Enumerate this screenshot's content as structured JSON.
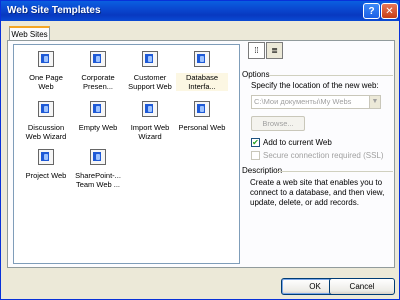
{
  "window": {
    "title": "Web Site Templates",
    "help_label": "?",
    "close_label": "✕"
  },
  "tabs": [
    {
      "label": "Web Sites"
    }
  ],
  "templates": [
    {
      "label": "One Page\nWeb",
      "icon": "one-page-web-icon"
    },
    {
      "label": "Corporate\nPresen...",
      "icon": "corporate-presence-icon"
    },
    {
      "label": "Customer\nSupport Web",
      "icon": "customer-support-icon"
    },
    {
      "label": "Database\nInterfa...",
      "icon": "database-interface-icon",
      "selected": true
    },
    {
      "label": "Discussion\nWeb Wizard",
      "icon": "discussion-web-icon"
    },
    {
      "label": "Empty Web",
      "icon": "empty-web-icon"
    },
    {
      "label": "Import Web\nWizard",
      "icon": "import-web-icon"
    },
    {
      "label": "Personal Web",
      "icon": "personal-web-icon"
    },
    {
      "label": "Project Web",
      "icon": "project-web-icon"
    },
    {
      "label": "SharePoint-...\nTeam Web ...",
      "icon": "sharepoint-team-icon"
    }
  ],
  "view_buttons": [
    {
      "label": "⁞⁞",
      "icon": "large-icons-view-icon"
    },
    {
      "label": "≣",
      "icon": "list-view-icon"
    }
  ],
  "options": {
    "heading": "Options",
    "location_label": "Specify the location of the new web:",
    "location_value": "C:\\Мои документы\\My Webs",
    "browse_label": "Browse...",
    "add_to_current_web_label": "Add to current Web",
    "add_to_current_web_checked": true,
    "secure_connection_label": "Secure connection required (SSL)",
    "secure_connection_checked": false
  },
  "description": {
    "heading": "Description",
    "text": "Create a web site that enables you to connect to a database, and then view, update, delete, or add records."
  },
  "buttons": {
    "ok": "OK",
    "cancel": "Cancel"
  }
}
